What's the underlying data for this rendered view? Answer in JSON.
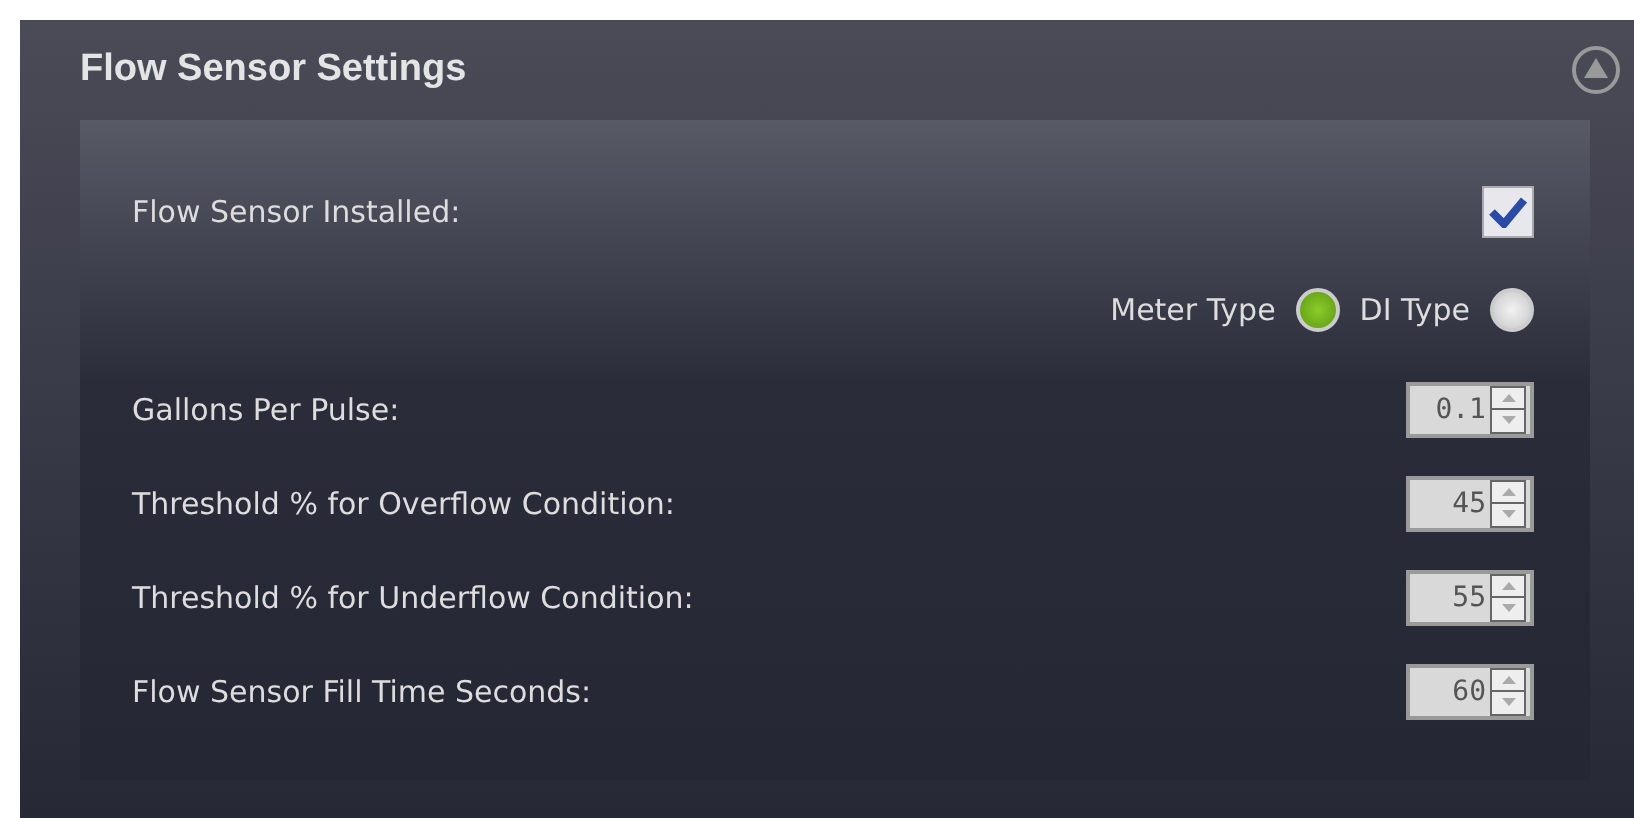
{
  "panel": {
    "title": "Flow Sensor Settings"
  },
  "installed": {
    "label": "Flow Sensor Installed:",
    "checked": true
  },
  "sensor_type": [
    {
      "label": "Meter Type",
      "selected": true
    },
    {
      "label": "DI Type",
      "selected": false
    }
  ],
  "fields": [
    {
      "label": "Gallons Per Pulse:",
      "value": "0.1"
    },
    {
      "label": "Threshold % for Overflow Condition:",
      "value": "45"
    },
    {
      "label": "Threshold % for Underflow Condition:",
      "value": "55"
    },
    {
      "label": "Flow Sensor Fill Time Seconds:",
      "value": "60"
    }
  ]
}
